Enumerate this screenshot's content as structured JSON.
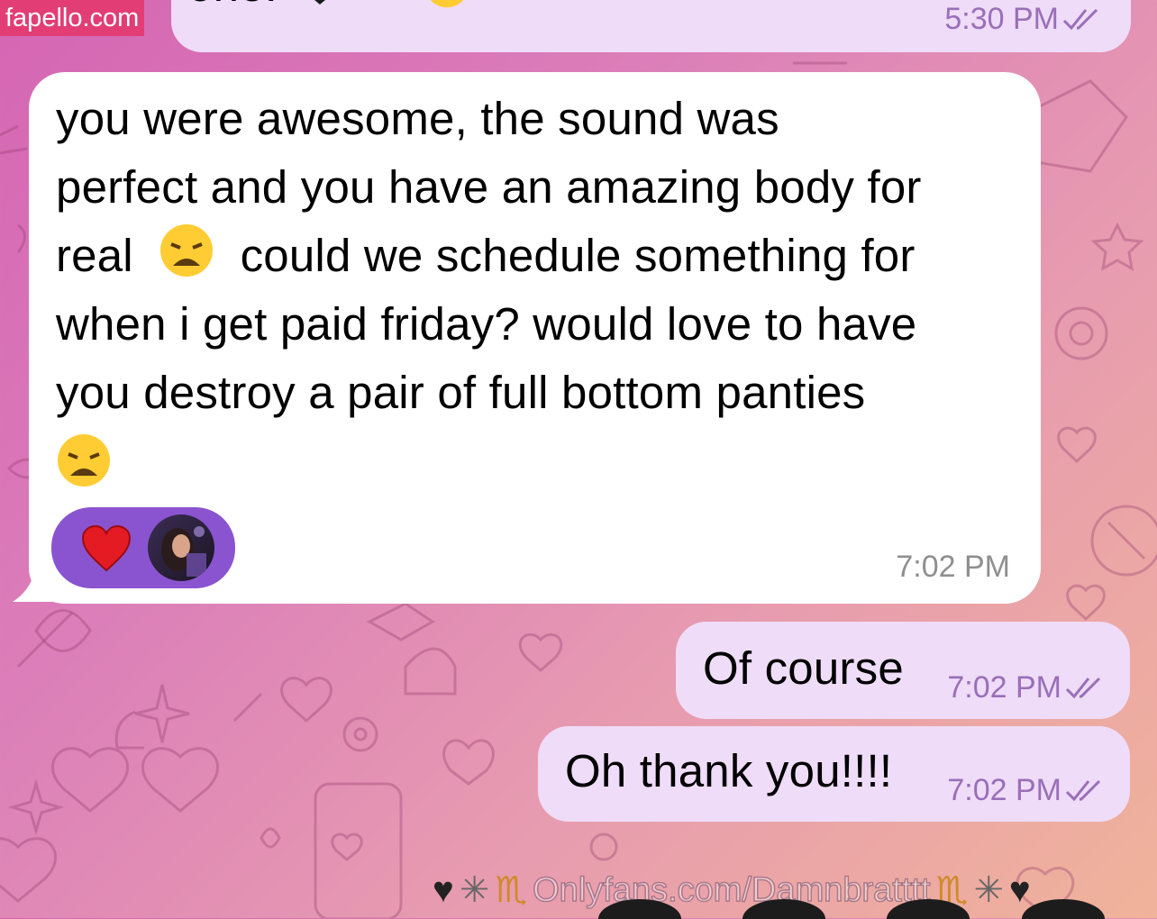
{
  "watermark": "fapello.com",
  "messages": [
    {
      "text_partial": "one!",
      "time": "5:30 PM"
    },
    {
      "lines": [
        "you were awesome, the sound was",
        "perfect and you have an amazing body for",
        "could we schedule something for",
        "when i get paid friday? would love to have",
        "you destroy a pair of full bottom panties"
      ],
      "line3_prefix": "real",
      "time": "7:02 PM",
      "reaction_icon": "red-heart-icon"
    },
    {
      "text": "Of course",
      "time": "7:02 PM"
    },
    {
      "text": "Oh thank you!!!!",
      "time": "7:02 PM"
    }
  ],
  "footer": {
    "text": "Onlyfans.com/Damnbratttt"
  },
  "colors": {
    "incoming_bubble": "#ffffff",
    "outgoing_bubble": "#efdcf8",
    "reaction_pill": "#8a54d0",
    "outgoing_meta": "#9a6fb8",
    "incoming_meta": "#8f8f8f"
  }
}
